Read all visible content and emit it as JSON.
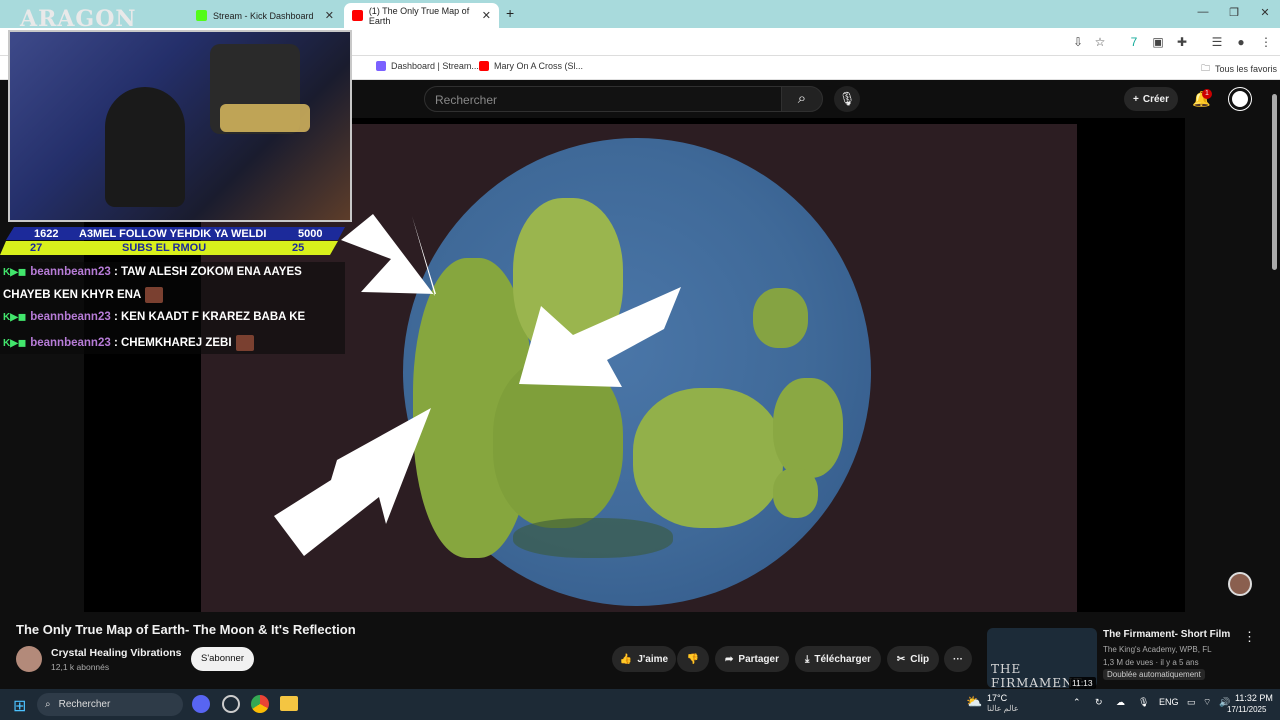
{
  "browser": {
    "tabs": [
      {
        "label": "Stream - Kick Dashboard",
        "active": false,
        "favicon_color": "#53fc18"
      },
      {
        "label": "(1) The Only True Map of Earth",
        "active": true,
        "favicon_color": "#ff0000"
      }
    ],
    "new_tab": "+",
    "window_controls": [
      "minimize-icon",
      "restore-icon",
      "close-icon"
    ],
    "bookmarks": [
      {
        "label": "Dashboard | Stream...",
        "favicon_color": "#7b61ff"
      },
      {
        "label": "Mary On A Cross (Sl...",
        "favicon_color": "#ff0000"
      }
    ],
    "all_bookmarks": "Tous les favoris"
  },
  "youtube": {
    "search_placeholder": "Rechercher",
    "create_label": "Créer",
    "notifications_count": "1",
    "video": {
      "title": "The Only True Map of Earth- The Moon & It's Reflection",
      "channel": "Crystal Healing Vibrations",
      "subscribers": "12,1 k abonnés",
      "subscribe_label": "S'abonner",
      "actions": {
        "like": "J'aime",
        "share": "Partager",
        "download": "Télécharger",
        "clip": "Clip",
        "more": "···"
      }
    },
    "recommendation": {
      "title": "The Firmament- Short Film",
      "channel": "The King's Academy, WPB, FL",
      "meta": "1,3 M de vues · il y a 5 ans",
      "badge": "Doublée automatiquement",
      "duration": "11:13",
      "thumb_text": "THE FIRMAMENT"
    }
  },
  "stream_overlay": {
    "logo": "ARAGON",
    "goal": {
      "left_top": "1622",
      "message": "A3MEL FOLLOW YEHDIK YA WELDI",
      "right_top": "5000",
      "left_bottom": "27",
      "sub_message": "SUBS EL RMOU",
      "right_bottom": "25"
    },
    "chat": [
      {
        "user": "beannbeann23",
        "text": ": TAW ALESH ZOKOM ENA AAYES",
        "cont": "CHAYEB KEN KHYR ENA"
      },
      {
        "user": "beannbeann23",
        "text": ": KEN KAADT F KRAREZ BABA KE"
      },
      {
        "user": "beannbeann23",
        "text": ": CHEMKHAREJ ZEBI"
      }
    ]
  },
  "taskbar": {
    "search": "Rechercher",
    "weather_temp": "17°C",
    "weather_text": "عالم عالنا",
    "lang": "ENG",
    "time": "11:32 PM",
    "date": "17/11/2025"
  }
}
